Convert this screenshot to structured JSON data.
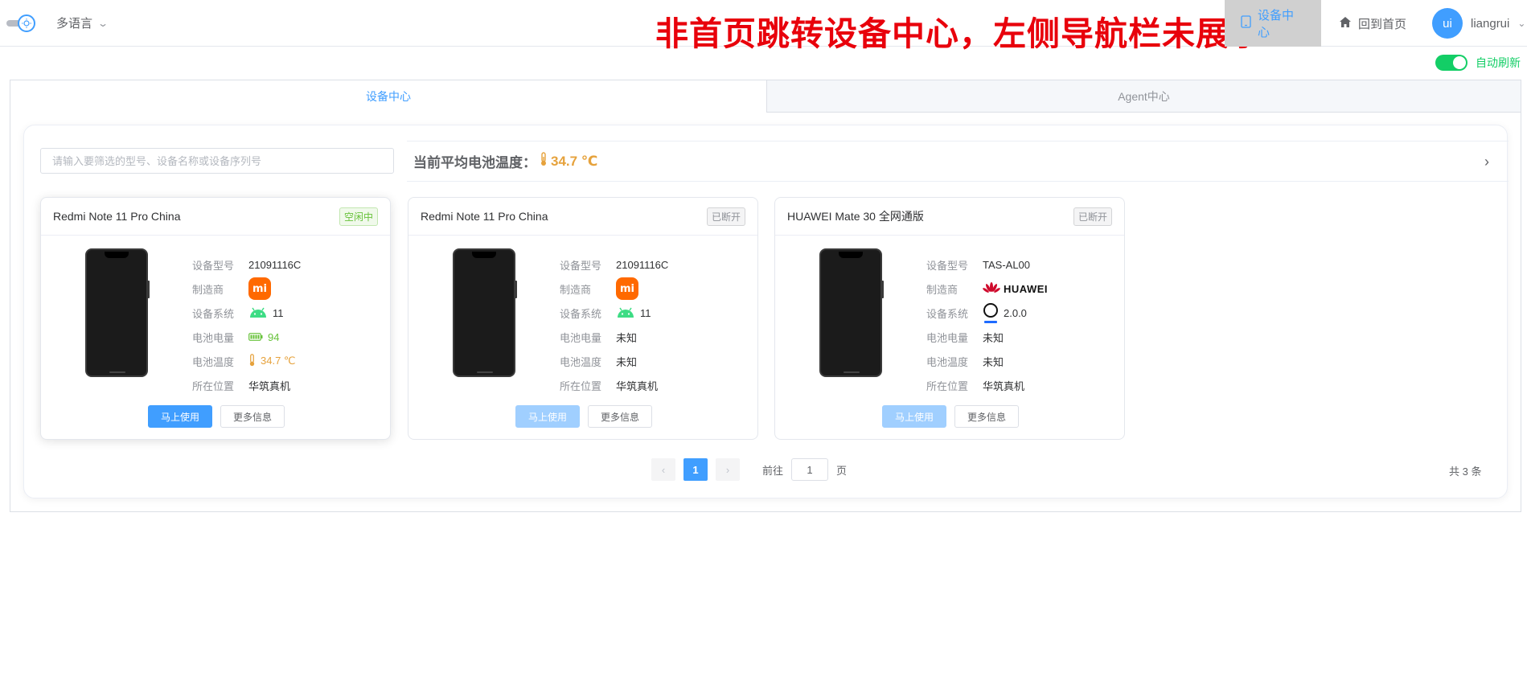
{
  "header": {
    "language_label": "多语言",
    "banner_text": "非首页跳转设备中心，左侧导航栏未展示",
    "nav_device": "设备中心",
    "nav_home": "回到首页",
    "avatar_text": "ui",
    "username": "liangrui"
  },
  "auto_refresh": {
    "label": "自动刷新",
    "on": true
  },
  "tabs": [
    {
      "label": "设备中心",
      "active": true
    },
    {
      "label": "Agent中心",
      "active": false
    }
  ],
  "search": {
    "placeholder": "请输入要筛选的型号、设备名称或设备序列号",
    "value": ""
  },
  "temperature": {
    "title": "当前平均电池温度：",
    "value": "34.7 ℃"
  },
  "field_labels": {
    "model": "设备型号",
    "maker": "制造商",
    "os": "设备系统",
    "battery": "电池电量",
    "temp": "电池温度",
    "location": "所在位置"
  },
  "devices": [
    {
      "name": "Redmi Note 11 Pro China",
      "status": "空闲中",
      "model": "21091116C",
      "maker_logo": "mi",
      "maker_icon": "mi-logo-icon",
      "os_icon": "android-icon",
      "os_version": "11",
      "battery": "94",
      "temp": "34.7 ℃",
      "location": "华筑真机",
      "use_label": "马上使用",
      "more_label": "更多信息"
    },
    {
      "name": "Redmi Note 11 Pro China",
      "status": "已断开",
      "model": "21091116C",
      "maker_logo": "mi",
      "maker_icon": "mi-logo-icon",
      "os_icon": "android-icon",
      "os_version": "11",
      "battery": "未知",
      "temp": "未知",
      "location": "华筑真机",
      "use_label": "马上使用",
      "more_label": "更多信息"
    },
    {
      "name": "HUAWEI Mate 30 全网通版",
      "status": "已断开",
      "model": "TAS-AL00",
      "maker_logo": "HUAWEI",
      "maker_icon": "huawei-logo-icon",
      "os_icon": "harmonyos-icon",
      "os_version": "2.0.0",
      "battery": "未知",
      "temp": "未知",
      "location": "华筑真机",
      "use_label": "马上使用",
      "more_label": "更多信息"
    }
  ],
  "pagination": {
    "current": "1",
    "goto_label": "前往",
    "goto_value": "1",
    "page_suffix": "页",
    "total": "共 3 条"
  },
  "colors": {
    "primary": "#409eff",
    "success": "#67c23a",
    "warning": "#e6a23c",
    "banner": "#e8000b",
    "toggle_on": "#13ce66"
  }
}
